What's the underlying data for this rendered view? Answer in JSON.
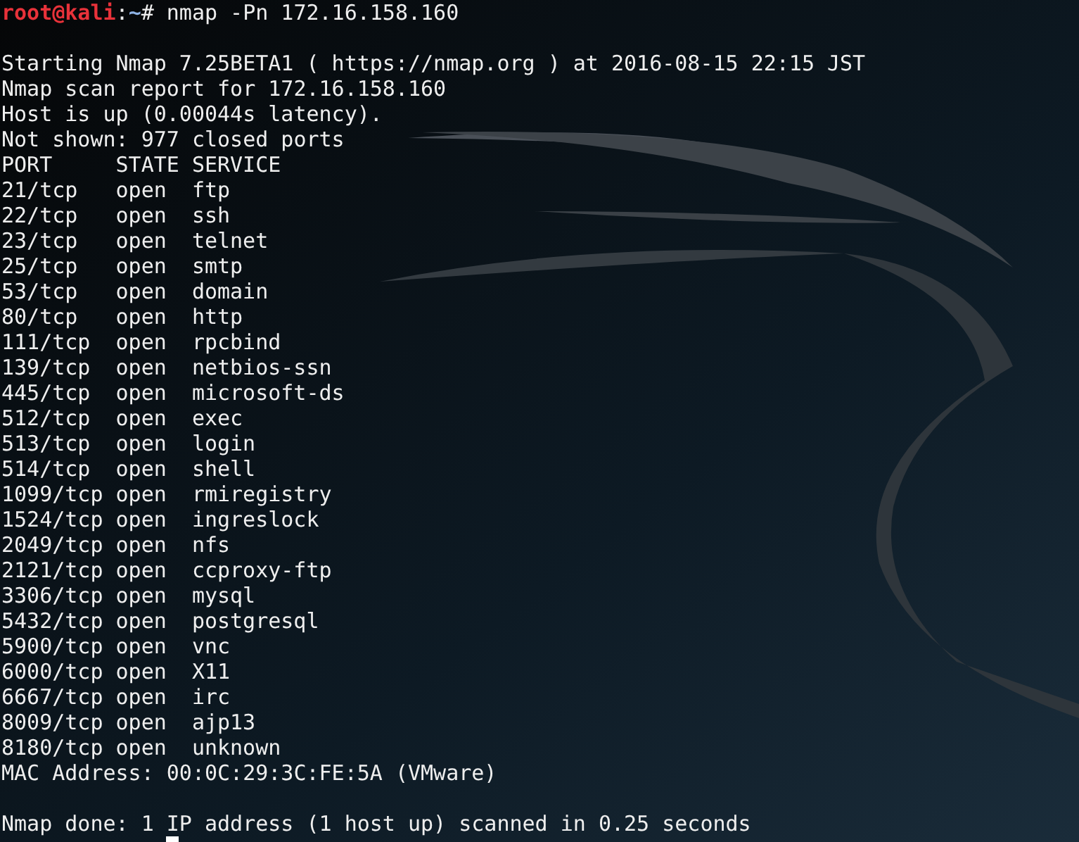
{
  "prompt": {
    "user": "root@kali",
    "separator": ":",
    "path": "~",
    "symbol": "#",
    "command": "nmap -Pn 172.16.158.160"
  },
  "output_lines": [
    "Starting Nmap 7.25BETA1 ( https://nmap.org ) at 2016-08-15 22:15 JST",
    "Nmap scan report for 172.16.158.160",
    "Host is up (0.00044s latency).",
    "Not shown: 977 closed ports"
  ],
  "table": {
    "columns": [
      "PORT",
      "STATE",
      "SERVICE"
    ],
    "rows": [
      [
        "21/tcp",
        "open",
        "ftp"
      ],
      [
        "22/tcp",
        "open",
        "ssh"
      ],
      [
        "23/tcp",
        "open",
        "telnet"
      ],
      [
        "25/tcp",
        "open",
        "smtp"
      ],
      [
        "53/tcp",
        "open",
        "domain"
      ],
      [
        "80/tcp",
        "open",
        "http"
      ],
      [
        "111/tcp",
        "open",
        "rpcbind"
      ],
      [
        "139/tcp",
        "open",
        "netbios-ssn"
      ],
      [
        "445/tcp",
        "open",
        "microsoft-ds"
      ],
      [
        "512/tcp",
        "open",
        "exec"
      ],
      [
        "513/tcp",
        "open",
        "login"
      ],
      [
        "514/tcp",
        "open",
        "shell"
      ],
      [
        "1099/tcp",
        "open",
        "rmiregistry"
      ],
      [
        "1524/tcp",
        "open",
        "ingreslock"
      ],
      [
        "2049/tcp",
        "open",
        "nfs"
      ],
      [
        "2121/tcp",
        "open",
        "ccproxy-ftp"
      ],
      [
        "3306/tcp",
        "open",
        "mysql"
      ],
      [
        "5432/tcp",
        "open",
        "postgresql"
      ],
      [
        "5900/tcp",
        "open",
        "vnc"
      ],
      [
        "6000/tcp",
        "open",
        "X11"
      ],
      [
        "6667/tcp",
        "open",
        "irc"
      ],
      [
        "8009/tcp",
        "open",
        "ajp13"
      ],
      [
        "8180/tcp",
        "open",
        "unknown"
      ]
    ]
  },
  "mac_line": "MAC Address: 00:0C:29:3C:FE:5A (VMware)",
  "done_line": "Nmap done: 1 IP address (1 host up) scanned in 0.25 seconds"
}
